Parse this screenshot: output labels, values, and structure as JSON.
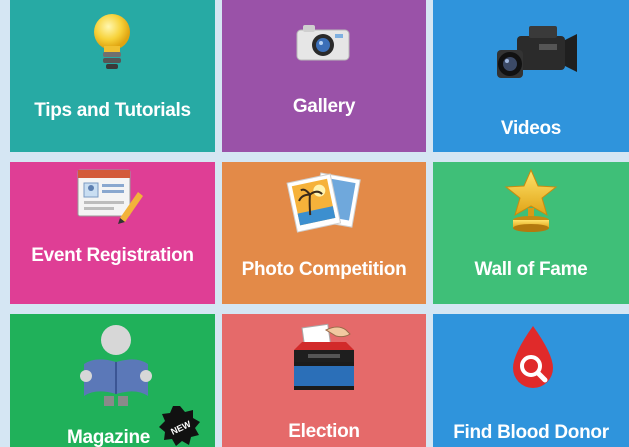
{
  "tiles": [
    {
      "label": "Tips and Tutorials",
      "icon": "lightbulb-icon",
      "color": "#27aaa4"
    },
    {
      "label": "Gallery",
      "icon": "camera-icon",
      "color": "#9a52a8"
    },
    {
      "label": "Videos",
      "icon": "video-camera-icon",
      "color": "#2f94dc"
    },
    {
      "label": "Event Registration",
      "icon": "registration-form-icon",
      "color": "#df3e95"
    },
    {
      "label": "Photo Competition",
      "icon": "photos-icon",
      "color": "#e38a48"
    },
    {
      "label": "Wall of Fame",
      "icon": "trophy-star-icon",
      "color": "#3fbf78"
    },
    {
      "label": "Magazine",
      "icon": "reader-icon",
      "color": "#20b15a",
      "badge": "NEW"
    },
    {
      "label": "Election",
      "icon": "ballot-box-icon",
      "color": "#e56a6a"
    },
    {
      "label": "Find Blood Donor",
      "icon": "blood-drop-search-icon",
      "color": "#2f94dc"
    }
  ]
}
